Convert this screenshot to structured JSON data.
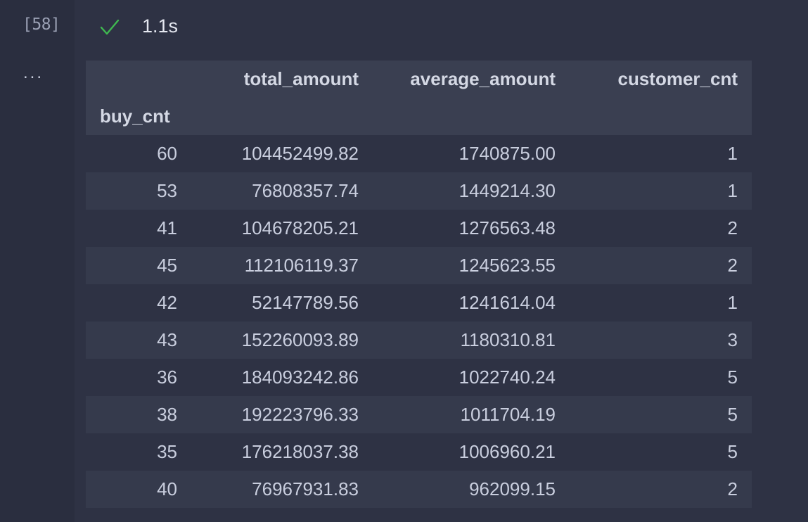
{
  "cell": {
    "execution_count": "[58]",
    "status_icon": "check-icon",
    "duration": "1.1s",
    "output_prompt": "...",
    "colors": {
      "success": "#3fb950",
      "background": "#262a3a",
      "header_bg": "#3a3f51",
      "stripe_bg": "#353a4c"
    }
  },
  "table": {
    "columns": [
      "",
      "total_amount",
      "average_amount",
      "customer_cnt"
    ],
    "index_name": "buy_cnt",
    "rows": [
      {
        "buy_cnt": "60",
        "total_amount": "104452499.82",
        "average_amount": "1740875.00",
        "customer_cnt": "1"
      },
      {
        "buy_cnt": "53",
        "total_amount": "76808357.74",
        "average_amount": "1449214.30",
        "customer_cnt": "1"
      },
      {
        "buy_cnt": "41",
        "total_amount": "104678205.21",
        "average_amount": "1276563.48",
        "customer_cnt": "2"
      },
      {
        "buy_cnt": "45",
        "total_amount": "112106119.37",
        "average_amount": "1245623.55",
        "customer_cnt": "2"
      },
      {
        "buy_cnt": "42",
        "total_amount": "52147789.56",
        "average_amount": "1241614.04",
        "customer_cnt": "1"
      },
      {
        "buy_cnt": "43",
        "total_amount": "152260093.89",
        "average_amount": "1180310.81",
        "customer_cnt": "3"
      },
      {
        "buy_cnt": "36",
        "total_amount": "184093242.86",
        "average_amount": "1022740.24",
        "customer_cnt": "5"
      },
      {
        "buy_cnt": "38",
        "total_amount": "192223796.33",
        "average_amount": "1011704.19",
        "customer_cnt": "5"
      },
      {
        "buy_cnt": "35",
        "total_amount": "176218037.38",
        "average_amount": "1006960.21",
        "customer_cnt": "5"
      },
      {
        "buy_cnt": "40",
        "total_amount": "76967931.83",
        "average_amount": "962099.15",
        "customer_cnt": "2"
      }
    ]
  }
}
